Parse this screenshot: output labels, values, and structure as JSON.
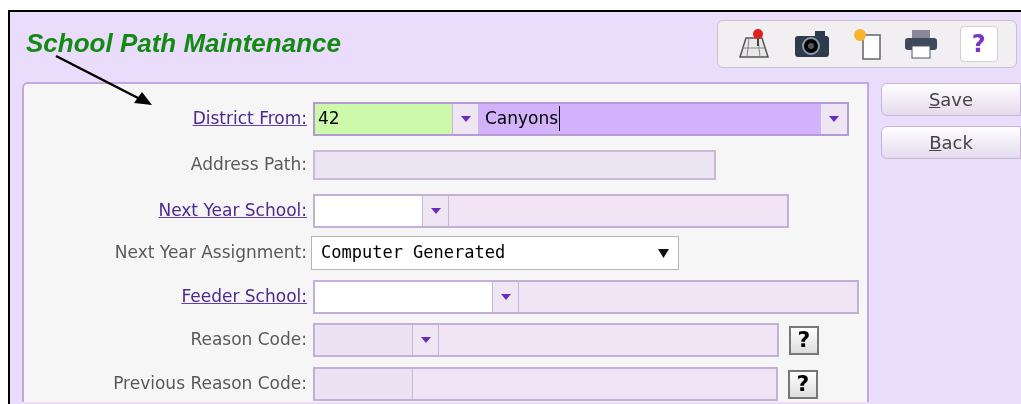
{
  "window": {
    "title": "School Path Maintenance"
  },
  "fields": [
    {
      "kind": "lookup",
      "label": "District From:",
      "link": true,
      "code": "42",
      "description": "Canyons",
      "highlighted": true,
      "disabled": false,
      "help": false
    },
    {
      "kind": "text",
      "label": "Address Path:",
      "link": false,
      "disabled": true,
      "help": false
    },
    {
      "kind": "lookup",
      "label": "Next Year School:",
      "link": true,
      "highlighted": false,
      "disabled": false,
      "help": false
    },
    {
      "kind": "select",
      "label": "Next Year Assignment:",
      "link": false,
      "value": "Computer Generated",
      "help": false
    },
    {
      "kind": "lookup",
      "label": "Feeder School:",
      "link": true,
      "highlighted": false,
      "disabled": false,
      "help": false
    },
    {
      "kind": "lookup",
      "label": "Reason Code:",
      "link": false,
      "highlighted": false,
      "disabled": true,
      "help": true,
      "help_label": "?"
    },
    {
      "kind": "codedesc",
      "label": "Previous Reason Code:",
      "link": false,
      "disabled": true,
      "help": true,
      "help_label": "?"
    }
  ],
  "toolbar": {
    "help_label": "?"
  },
  "buttons": [
    {
      "label": "Save"
    },
    {
      "label": "Back"
    }
  ]
}
